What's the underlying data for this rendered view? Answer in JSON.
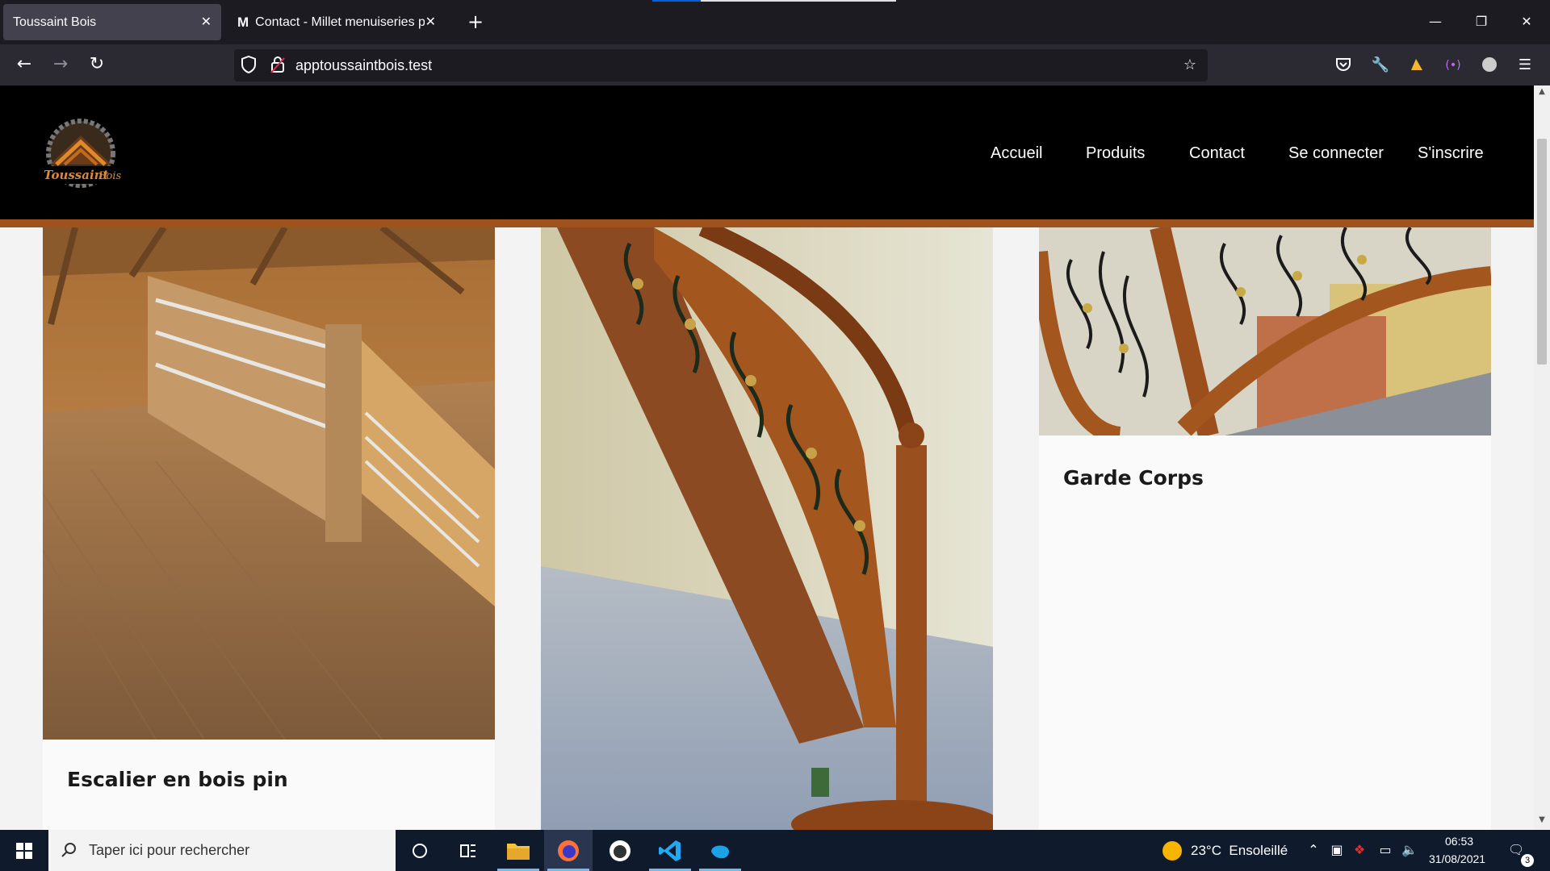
{
  "browser": {
    "tabs": [
      {
        "title": "Toussaint Bois",
        "active": true
      },
      {
        "title": "Contact - Millet menuiseries portes et fenêtres",
        "active": false
      }
    ],
    "url": "apptoussaintbois.test",
    "icons": {
      "back": "arrow-left-icon",
      "forward": "arrow-right-icon",
      "reload": "reload-icon",
      "shield": "shield-icon",
      "lock": "lock-icon",
      "bookmark": "star-icon",
      "pocket": "pocket-icon",
      "tools": "wrench-icon",
      "menu": "hamburger-icon"
    }
  },
  "site": {
    "brand": "Toussaint Bois",
    "nav": [
      "Accueil",
      "Produits",
      "Contact",
      "Se connecter",
      "S'inscrire"
    ],
    "accent_color": "#a0521d",
    "cards": [
      {
        "title": "Escalier en bois pin",
        "image": "pine-wood-staircase"
      },
      {
        "title": "",
        "image": "curved-wood-staircase-wrought-iron"
      },
      {
        "title": "Garde Corps",
        "image": "wrought-iron-railing"
      }
    ]
  },
  "taskbar": {
    "search_placeholder": "Taper ici pour rechercher",
    "weather": "23°C  Ensoleillé",
    "time": "06:53",
    "date": "31/08/2021",
    "notification_count": "3"
  }
}
